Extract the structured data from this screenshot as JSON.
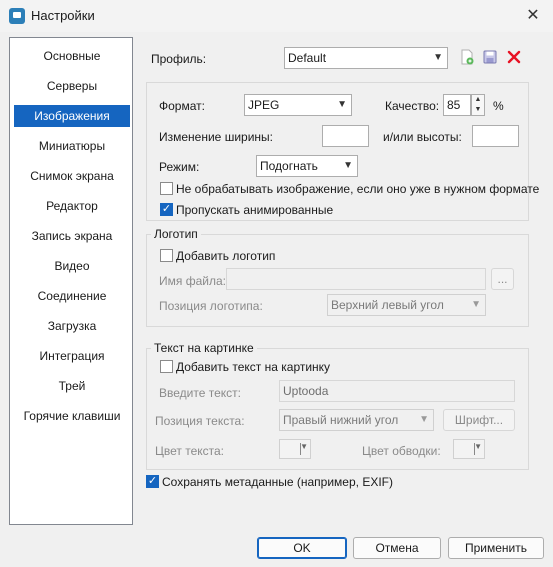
{
  "window": {
    "title": "Настройки",
    "close": "✕"
  },
  "sidebar": {
    "items": [
      {
        "label": "Основные"
      },
      {
        "label": "Серверы"
      },
      {
        "label": "Изображения"
      },
      {
        "label": "Миниатюры"
      },
      {
        "label": "Снимок экрана"
      },
      {
        "label": "Редактор"
      },
      {
        "label": "Запись экрана"
      },
      {
        "label": "Видео"
      },
      {
        "label": "Соединение"
      },
      {
        "label": "Загрузка"
      },
      {
        "label": "Интеграция"
      },
      {
        "label": "Трей"
      },
      {
        "label": "Горячие клавиши"
      }
    ],
    "selected": "Изображения"
  },
  "profile": {
    "label": "Профиль:",
    "value": "Default"
  },
  "format": {
    "format_label": "Формат:",
    "format_value": "JPEG",
    "quality_label": "Качество:",
    "quality_value": "85",
    "quality_unit": "%",
    "width_label": "Изменение ширины:",
    "width_value": "",
    "height_label": "и/или высоты:",
    "height_value": "",
    "mode_label": "Режим:",
    "mode_value": "Подогнать",
    "skip_label": "Не обрабатывать изображение, если оно уже в нужном формате",
    "skip_checked": false,
    "skip_animated_label": "Пропускать анимированные",
    "skip_animated_checked": true
  },
  "logo": {
    "group_title": "Логотип",
    "add_label": "Добавить логотип",
    "add_checked": false,
    "file_label": "Имя файла:",
    "file_value": "",
    "browse": "...",
    "position_label": "Позиция логотипа:",
    "position_value": "Верхний левый угол"
  },
  "text": {
    "group_title": "Текст на картинке",
    "add_label": "Добавить текст на картинку",
    "add_checked": false,
    "input_label": "Введите текст:",
    "input_value": "Uptooda",
    "position_label": "Позиция текста:",
    "position_value": "Правый нижний угол",
    "font_button": "Шрифт...",
    "color_label": "Цвет текста:",
    "stroke_label": "Цвет обводки:"
  },
  "metadata": {
    "label": "Сохранять метаданные (например, EXIF)",
    "checked": true
  },
  "buttons": {
    "ok": "OK",
    "cancel": "Отмена",
    "apply": "Применить"
  },
  "colors": {
    "accent": "#1565c0",
    "delete": "#e81123",
    "add": "#5cb85c"
  }
}
